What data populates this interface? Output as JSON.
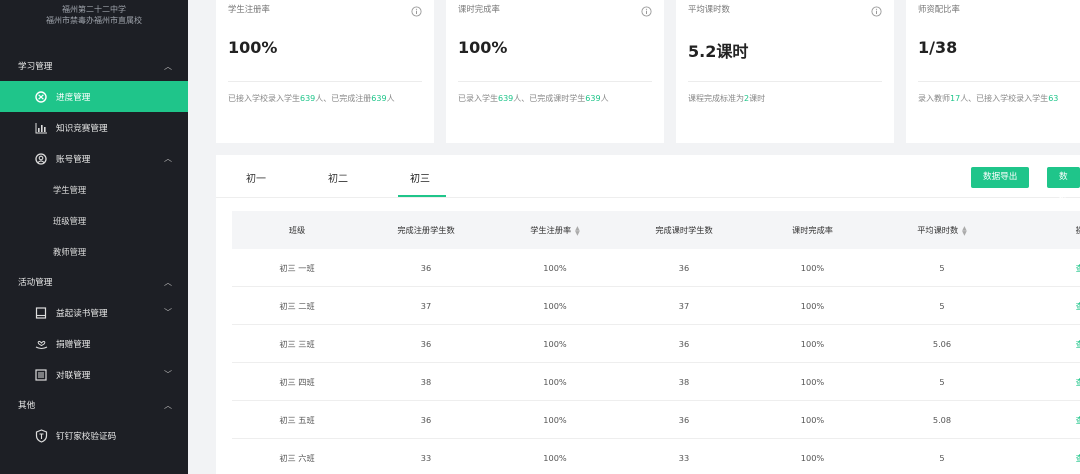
{
  "sidebar": {
    "school_line1": "福州第二十二中学",
    "school_line2": "福州市禁毒办福州市直属校",
    "sections": {
      "learning": "学习管理",
      "activities": "活动管理",
      "others": "其他"
    },
    "items": {
      "progress": "进度管理",
      "contest": "知识竞赛管理",
      "account": "账号管理",
      "reading": "益起读书管理",
      "donation": "捐赠管理",
      "couplet": "对联管理",
      "dingding": "钉钉家校验证码"
    },
    "account_sub": [
      "学生管理",
      "班级管理",
      "教师管理"
    ],
    "active_color": "#1fc58a"
  },
  "cards": [
    {
      "label": "学生注册率",
      "value": "100%",
      "sub_a": "已接入学校录入学生",
      "sub_n1": "639",
      "sub_b": "人、已完成注册",
      "sub_n2": "639",
      "sub_c": "人"
    },
    {
      "label": "课时完成率",
      "value": "100%",
      "sub_a": "已录入学生",
      "sub_n1": "639",
      "sub_b": "人、已完成课时学生",
      "sub_n2": "639",
      "sub_c": "人"
    },
    {
      "label": "平均课时数",
      "value": "5.2课时",
      "sub_a": "课程完成标准为",
      "sub_n1": "2",
      "sub_b": "课时",
      "sub_n2": "",
      "sub_c": ""
    },
    {
      "label": "师资配比率",
      "value": "1/38",
      "sub_a": "录入教师",
      "sub_n1": "17",
      "sub_b": "人、已接入学校录入学生",
      "sub_n2": "63",
      "sub_c": ""
    }
  ],
  "tabs": [
    "初一",
    "初二",
    "初三"
  ],
  "buttons": {
    "export": "数据导出",
    "import": "数据"
  },
  "table": {
    "headers": [
      "班级",
      "完成注册学生数",
      "学生注册率",
      "完成课时学生数",
      "课时完成率",
      "平均课时数",
      "操作"
    ],
    "rows": [
      [
        "初三 一班",
        "36",
        "100%",
        "36",
        "100%",
        "5",
        "查看"
      ],
      [
        "初三 二班",
        "37",
        "100%",
        "37",
        "100%",
        "5",
        "查看"
      ],
      [
        "初三 三班",
        "36",
        "100%",
        "36",
        "100%",
        "5.06",
        "查看"
      ],
      [
        "初三 四班",
        "38",
        "100%",
        "38",
        "100%",
        "5",
        "查看"
      ],
      [
        "初三 五班",
        "36",
        "100%",
        "36",
        "100%",
        "5.08",
        "查看"
      ],
      [
        "初三 六班",
        "33",
        "100%",
        "33",
        "100%",
        "5",
        "查看"
      ]
    ]
  }
}
